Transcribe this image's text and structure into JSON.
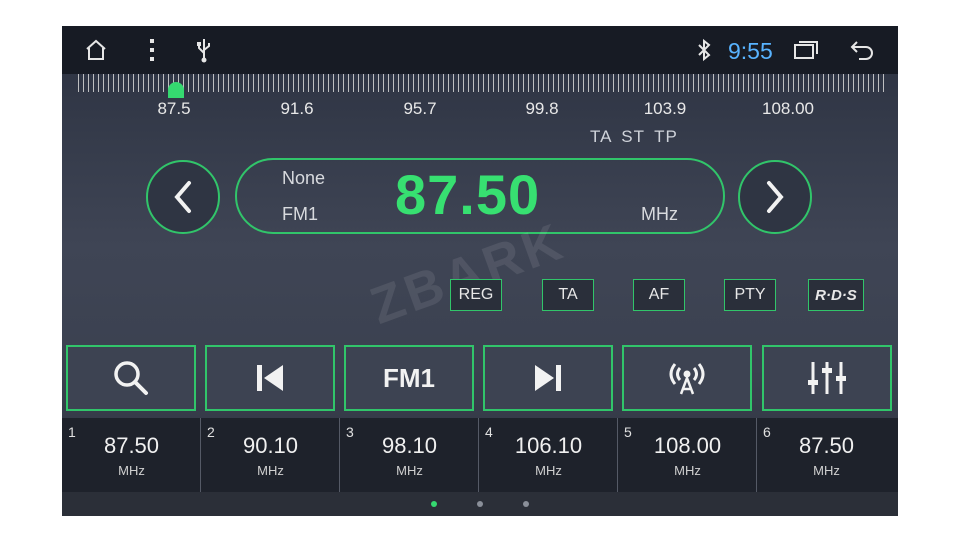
{
  "status_bar": {
    "icons": [
      "home-icon",
      "more-vertical-icon",
      "usb-icon",
      "bluetooth-icon",
      "recent-apps-icon",
      "back-icon"
    ],
    "time": "9:55"
  },
  "tuner": {
    "scale_labels": [
      "87.5",
      "91.6",
      "95.7",
      "99.8",
      "103.9",
      "108.00"
    ],
    "flags": "TA ST TP",
    "ps_name": "None",
    "band": "FM1",
    "frequency": "87.50",
    "unit": "MHz",
    "prev_icon": "chevron-left-icon",
    "next_icon": "chevron-right-icon"
  },
  "watermark": "ZBARK",
  "options": [
    {
      "label": "REG"
    },
    {
      "label": "TA"
    },
    {
      "label": "AF"
    },
    {
      "label": "PTY"
    },
    {
      "label": "R·D·S"
    }
  ],
  "controls": {
    "search_icon": "search-icon",
    "prev_icon": "skip-previous-icon",
    "band_label": "FM1",
    "next_icon": "skip-next-icon",
    "antenna_icon": "antenna-icon",
    "eq_icon": "equalizer-icon"
  },
  "presets": [
    {
      "num": "1",
      "freq": "87.50",
      "unit": "MHz"
    },
    {
      "num": "2",
      "freq": "90.10",
      "unit": "MHz"
    },
    {
      "num": "3",
      "freq": "98.10",
      "unit": "MHz"
    },
    {
      "num": "4",
      "freq": "106.10",
      "unit": "MHz"
    },
    {
      "num": "5",
      "freq": "108.00",
      "unit": "MHz"
    },
    {
      "num": "6",
      "freq": "87.50",
      "unit": "MHz"
    }
  ],
  "pager": {
    "pages": 3,
    "active": 1
  },
  "colors": {
    "accent": "#35d970",
    "clock": "#58b3ff"
  }
}
